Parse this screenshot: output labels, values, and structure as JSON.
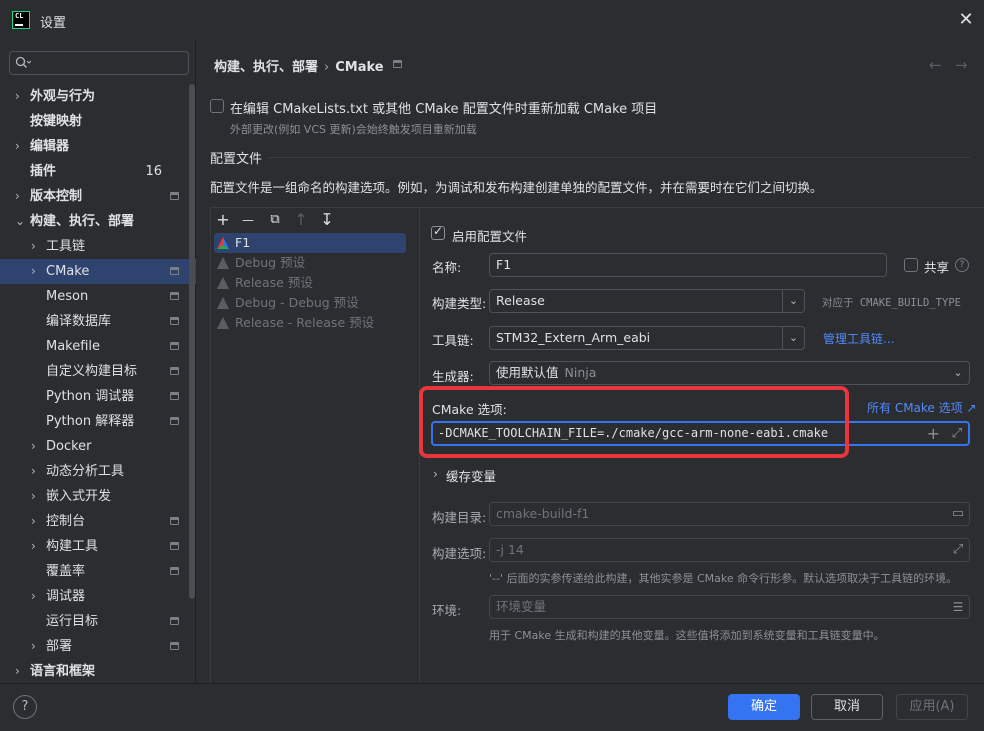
{
  "window": {
    "title": "设置",
    "logo_text": "CL"
  },
  "search": {
    "placeholder": ""
  },
  "sidebar": {
    "items": [
      {
        "label": "外观与行为",
        "chevron": "›",
        "indent": 1,
        "bold": true
      },
      {
        "label": "按键映射",
        "chevron": "",
        "indent": 1,
        "bold": true
      },
      {
        "label": "编辑器",
        "chevron": "›",
        "indent": 1,
        "bold": true
      },
      {
        "label": "插件",
        "chevron": "",
        "indent": 1,
        "bold": true,
        "count": "16"
      },
      {
        "label": "版本控制",
        "chevron": "›",
        "indent": 1,
        "bold": true,
        "project": true
      },
      {
        "label": "构建、执行、部署",
        "chevron": "⌄",
        "indent": 1,
        "bold": true
      },
      {
        "label": "工具链",
        "chevron": "›",
        "indent": 2
      },
      {
        "label": "CMake",
        "chevron": "›",
        "indent": 2,
        "project": true,
        "selected": true
      },
      {
        "label": "Meson",
        "chevron": "",
        "indent": 2,
        "project": true
      },
      {
        "label": "编译数据库",
        "chevron": "",
        "indent": 2,
        "project": true
      },
      {
        "label": "Makefile",
        "chevron": "",
        "indent": 2,
        "project": true
      },
      {
        "label": "自定义构建目标",
        "chevron": "",
        "indent": 2,
        "project": true
      },
      {
        "label": "Python 调试器",
        "chevron": "",
        "indent": 2,
        "project": true
      },
      {
        "label": "Python 解释器",
        "chevron": "",
        "indent": 2,
        "project": true
      },
      {
        "label": "Docker",
        "chevron": "›",
        "indent": 2
      },
      {
        "label": "动态分析工具",
        "chevron": "›",
        "indent": 2
      },
      {
        "label": "嵌入式开发",
        "chevron": "›",
        "indent": 2
      },
      {
        "label": "控制台",
        "chevron": "›",
        "indent": 2,
        "project": true
      },
      {
        "label": "构建工具",
        "chevron": "›",
        "indent": 2,
        "project": true
      },
      {
        "label": "覆盖率",
        "chevron": "",
        "indent": 2,
        "project": true
      },
      {
        "label": "调试器",
        "chevron": "›",
        "indent": 2
      },
      {
        "label": "运行目标",
        "chevron": "",
        "indent": 2,
        "project": true
      },
      {
        "label": "部署",
        "chevron": "›",
        "indent": 2,
        "project": true
      },
      {
        "label": "语言和框架",
        "chevron": "›",
        "indent": 1,
        "bold": true
      }
    ]
  },
  "header": {
    "breadcrumb_parent": "构建、执行、部署",
    "breadcrumb_sep": "›",
    "breadcrumb_current": "CMake",
    "back_icon": "←",
    "forward_icon": "→"
  },
  "reload": {
    "label": "在编辑 CMakeLists.txt 或其他 CMake 配置文件时重新加载 CMake 项目",
    "hint": "外部更改(例如 VCS 更新)会始终触发项目重新加载",
    "checked": false
  },
  "profiles": {
    "heading": "配置文件",
    "description": "配置文件是一组命名的构建选项。例如，为调试和发布构建创建单独的配置文件，并在需要时在它们之间切换。",
    "toolbar": {
      "add": "+",
      "remove": "—",
      "copy": "⧉",
      "up": "↑",
      "down": "↧"
    },
    "items": [
      {
        "name": "F1",
        "selected": true,
        "enabled": true
      },
      {
        "name": "Debug 预设",
        "enabled": false
      },
      {
        "name": "Release 预设",
        "enabled": false
      },
      {
        "name": "Debug - Debug 预设",
        "enabled": false
      },
      {
        "name": "Release - Release 预设",
        "enabled": false
      }
    ]
  },
  "detail": {
    "enable_label": "启用配置文件",
    "name_label": "名称:",
    "name_value": "F1",
    "share_label": "共享",
    "build_type_label": "构建类型:",
    "build_type_value": "Release",
    "build_type_hint": "对应于 CMAKE_BUILD_TYPE",
    "toolchain_label": "工具链:",
    "toolchain_value": "STM32_Extern_Arm_eabi",
    "manage_toolchains_link": "管理工具链...",
    "generator_label": "生成器:",
    "generator_value": "使用默认值",
    "generator_hint": "Ninja",
    "cmake_options_label": "CMake 选项:",
    "all_cmake_options_link": "所有 CMake 选项 ↗",
    "cmake_options_value": "-DCMAKE_TOOLCHAIN_FILE=./cmake/gcc-arm-none-eabi.cmake",
    "cache_vars_label": "缓存变量",
    "build_dir_label": "构建目录:",
    "build_dir_placeholder": "cmake-build-f1",
    "build_options_label": "构建选项:",
    "build_options_placeholder": "-j 14",
    "build_options_hint": "'--' 后面的实参传递给此构建，其他实参是 CMake 命令行形参。默认选项取决于工具链的环境。",
    "env_label": "环境:",
    "env_placeholder": "环境变量",
    "env_hint": "用于 CMake 生成和构建的其他变量。这些值将添加到系统变量和工具链变量中。"
  },
  "footer": {
    "help": "?",
    "ok": "确定",
    "cancel": "取消",
    "apply": "应用(A)"
  },
  "colors": {
    "accent": "#3574f0",
    "highlight_box": "#e8363c",
    "selection": "#2e436e",
    "link": "#548af7"
  }
}
